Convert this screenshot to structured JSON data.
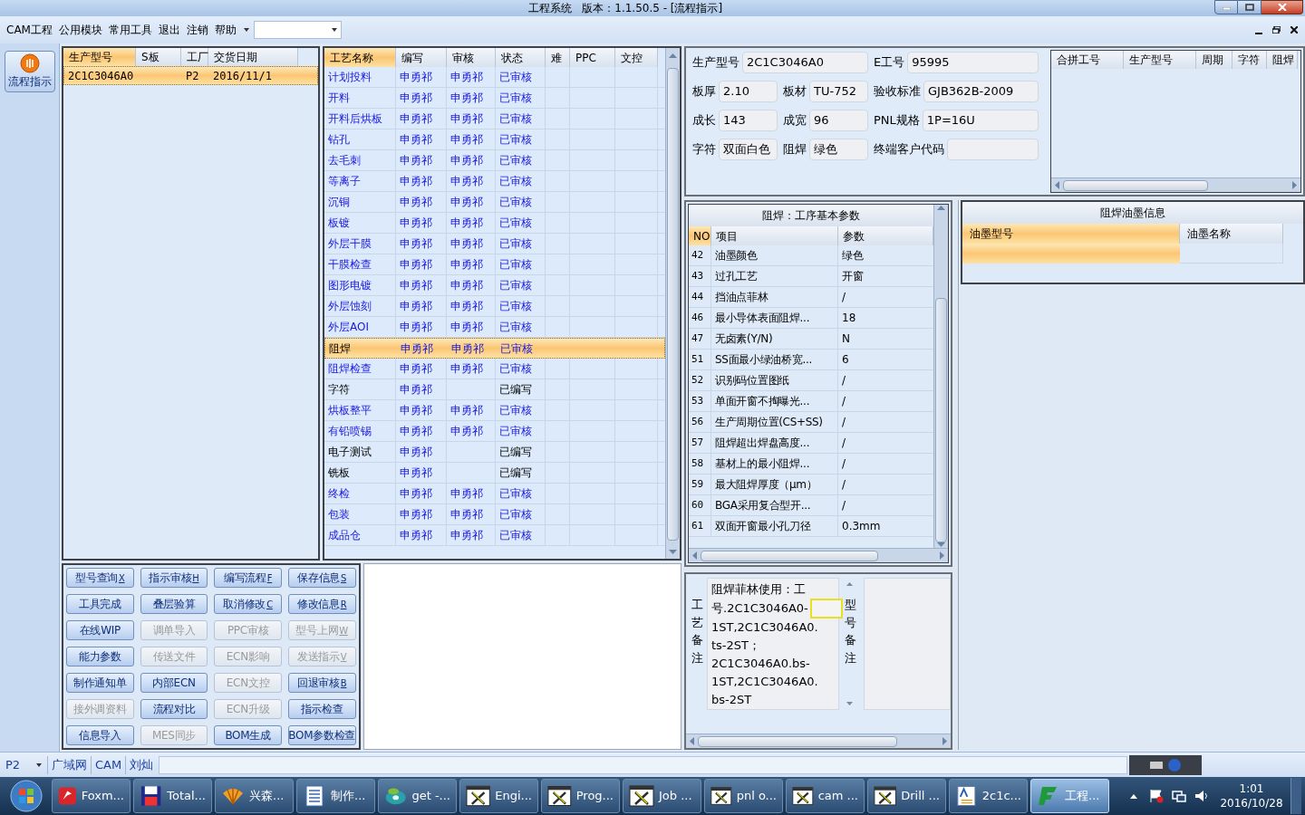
{
  "window": {
    "title": "工程系统   版本：1.1.50.5 - [流程指示]"
  },
  "menu": [
    {
      "label": "CAM工程"
    },
    {
      "label": "公用模块"
    },
    {
      "label": "常用工具"
    },
    {
      "label": "退出"
    },
    {
      "label": "注销"
    },
    {
      "label": "帮助"
    }
  ],
  "side_tool": {
    "label": "流程指示",
    "selected": true
  },
  "order_list": {
    "columns": [
      {
        "label": "生产型号",
        "selected": true
      },
      {
        "label": "S板",
        "selected": false
      },
      {
        "label": "工厂",
        "selected": false
      },
      {
        "label": "交货日期",
        "selected": false
      }
    ],
    "rows": [
      {
        "model": "2C1C3046A0",
        "factory": "P2",
        "date": "2016/11/1",
        "selected": true
      }
    ]
  },
  "process_table": {
    "columns": [
      {
        "label": "工艺名称",
        "selected": true
      },
      {
        "label": "编写",
        "selected": false
      },
      {
        "label": "审核",
        "selected": false
      },
      {
        "label": "状态",
        "selected": false
      },
      {
        "label": "难",
        "selected": false
      },
      {
        "label": "PPC",
        "selected": false
      },
      {
        "label": "文控",
        "selected": false
      }
    ],
    "rows": [
      {
        "name": "计划投料",
        "writer": "申勇祁",
        "reviewer": "申勇祁",
        "status": "已审核",
        "reviewed": true,
        "selected": false
      },
      {
        "name": "开料",
        "writer": "申勇祁",
        "reviewer": "申勇祁",
        "status": "已审核",
        "reviewed": true,
        "selected": false
      },
      {
        "name": "开料后烘板",
        "writer": "申勇祁",
        "reviewer": "申勇祁",
        "status": "已审核",
        "reviewed": true,
        "selected": false
      },
      {
        "name": "钻孔",
        "writer": "申勇祁",
        "reviewer": "申勇祁",
        "status": "已审核",
        "reviewed": true,
        "selected": false
      },
      {
        "name": "去毛刺",
        "writer": "申勇祁",
        "reviewer": "申勇祁",
        "status": "已审核",
        "reviewed": true,
        "selected": false
      },
      {
        "name": "等离子",
        "writer": "申勇祁",
        "reviewer": "申勇祁",
        "status": "已审核",
        "reviewed": true,
        "selected": false
      },
      {
        "name": "沉铜",
        "writer": "申勇祁",
        "reviewer": "申勇祁",
        "status": "已审核",
        "reviewed": true,
        "selected": false
      },
      {
        "name": "板镀",
        "writer": "申勇祁",
        "reviewer": "申勇祁",
        "status": "已审核",
        "reviewed": true,
        "selected": false
      },
      {
        "name": "外层干膜",
        "writer": "申勇祁",
        "reviewer": "申勇祁",
        "status": "已审核",
        "reviewed": true,
        "selected": false
      },
      {
        "name": "干膜检查",
        "writer": "申勇祁",
        "reviewer": "申勇祁",
        "status": "已审核",
        "reviewed": true,
        "selected": false
      },
      {
        "name": "图形电镀",
        "writer": "申勇祁",
        "reviewer": "申勇祁",
        "status": "已审核",
        "reviewed": true,
        "selected": false
      },
      {
        "name": "外层蚀刻",
        "writer": "申勇祁",
        "reviewer": "申勇祁",
        "status": "已审核",
        "reviewed": true,
        "selected": false
      },
      {
        "name": "外层AOI",
        "writer": "申勇祁",
        "reviewer": "申勇祁",
        "status": "已审核",
        "reviewed": true,
        "selected": false
      },
      {
        "name": "阻焊",
        "writer": "申勇祁",
        "reviewer": "申勇祁",
        "status": "已审核",
        "reviewed": true,
        "selected": true
      },
      {
        "name": "阻焊检查",
        "writer": "申勇祁",
        "reviewer": "申勇祁",
        "status": "已审核",
        "reviewed": true,
        "selected": false
      },
      {
        "name": "字符",
        "writer": "申勇祁",
        "status": "已编写",
        "reviewed": false,
        "selected": false
      },
      {
        "name": "烘板整平",
        "writer": "申勇祁",
        "reviewer": "申勇祁",
        "status": "已审核",
        "reviewed": true,
        "selected": false
      },
      {
        "name": "有铅喷锡",
        "writer": "申勇祁",
        "reviewer": "申勇祁",
        "status": "已审核",
        "reviewed": true,
        "selected": false
      },
      {
        "name": "电子测试",
        "writer": "申勇祁",
        "status": "已编写",
        "reviewed": false,
        "selected": false
      },
      {
        "name": "铣板",
        "writer": "申勇祁",
        "status": "已编写",
        "reviewed": false,
        "selected": false
      },
      {
        "name": "终检",
        "writer": "申勇祁",
        "reviewer": "申勇祁",
        "status": "已审核",
        "reviewed": true,
        "selected": false
      },
      {
        "name": "包装",
        "writer": "申勇祁",
        "reviewer": "申勇祁",
        "status": "已审核",
        "reviewed": true,
        "selected": false
      },
      {
        "name": "成品仓",
        "writer": "申勇祁",
        "reviewer": "申勇祁",
        "status": "已审核",
        "reviewed": true,
        "selected": false
      }
    ]
  },
  "buttons": [
    {
      "label": "型号查询",
      "shortcut": "X",
      "disabled": false
    },
    {
      "label": "指示审核",
      "shortcut": "H",
      "disabled": false
    },
    {
      "label": "编写流程",
      "shortcut": "F",
      "disabled": false
    },
    {
      "label": "保存信息",
      "shortcut": "S",
      "disabled": false
    },
    {
      "label": "工具完成",
      "disabled": false
    },
    {
      "label": "叠层验算",
      "disabled": false
    },
    {
      "label": "取消修改",
      "shortcut": "C",
      "disabled": false
    },
    {
      "label": "修改信息",
      "shortcut": "R",
      "disabled": false
    },
    {
      "label": "在线WIP",
      "disabled": false
    },
    {
      "label": "调单导入",
      "disabled": true
    },
    {
      "label": "PPC审核",
      "disabled": true
    },
    {
      "label": "型号上网",
      "shortcut": "W",
      "disabled": true
    },
    {
      "label": "能力参数",
      "disabled": false
    },
    {
      "label": "传送文件",
      "disabled": true
    },
    {
      "label": "ECN影响",
      "disabled": true
    },
    {
      "label": "发送指示",
      "shortcut": "V",
      "disabled": true
    },
    {
      "label": "制作通知单",
      "disabled": false
    },
    {
      "label": "内部ECN",
      "disabled": false
    },
    {
      "label": "ECN文控",
      "disabled": true
    },
    {
      "label": "回退审核",
      "shortcut": "B",
      "disabled": false
    },
    {
      "label": "接外调资料",
      "disabled": true
    },
    {
      "label": "流程对比",
      "disabled": false
    },
    {
      "label": "ECN升级",
      "disabled": true
    },
    {
      "label": "指示检查",
      "disabled": false
    },
    {
      "label": "信息导入",
      "disabled": false
    },
    {
      "label": "MES同步",
      "disabled": true
    },
    {
      "label": "BOM生成",
      "disabled": false
    },
    {
      "label": "BOM参数检查",
      "disabled": false
    }
  ],
  "info": {
    "fields": [
      {
        "label": "生产型号",
        "value": "2C1C3046A0"
      },
      {
        "label": "E工号",
        "value": "95995"
      },
      {
        "label": "板厚",
        "value": "2.10"
      },
      {
        "label": "板材",
        "value": "TU-752"
      },
      {
        "label": "验收标准",
        "value": "GJB362B-2009"
      },
      {
        "label": "成长",
        "value": "143"
      },
      {
        "label": "成宽",
        "value": "96"
      },
      {
        "label": "PNL规格",
        "value": "1P=16U"
      },
      {
        "label": "字符",
        "value": "双面白色"
      },
      {
        "label": "阻焊",
        "value": "绿色"
      },
      {
        "label": "终端客户代码"
      }
    ]
  },
  "merge_table": {
    "columns": [
      "合拼工号",
      "生产型号",
      "周期",
      "字符",
      "阻焊"
    ]
  },
  "params": {
    "title": "阻焊：工序基本参数",
    "columns": [
      {
        "label": "NO",
        "selected": true
      },
      {
        "label": "项目",
        "selected": false
      },
      {
        "label": "参数",
        "selected": false
      }
    ],
    "rows": [
      {
        "no": "42",
        "item": "油墨颜色",
        "value": "绿色"
      },
      {
        "no": "43",
        "item": "过孔工艺",
        "value": "开窗"
      },
      {
        "no": "44",
        "item": "挡油点菲林",
        "value": "/"
      },
      {
        "no": "46",
        "item": "最小导体表面阻焊...",
        "value": "18"
      },
      {
        "no": "47",
        "item": "无卤素(Y/N)",
        "value": "N"
      },
      {
        "no": "51",
        "item": "SS面最小绿油桥宽...",
        "value": "6"
      },
      {
        "no": "52",
        "item": "识别码位置图纸",
        "value": "/"
      },
      {
        "no": "53",
        "item": "单面开窗不掏曝光...",
        "value": "/"
      },
      {
        "no": "56",
        "item": "生产周期位置(CS+SS)",
        "value": "/"
      },
      {
        "no": "57",
        "item": "阻焊超出焊盘高度...",
        "value": "/"
      },
      {
        "no": "58",
        "item": "基材上的最小阻焊...",
        "value": "/"
      },
      {
        "no": "59",
        "item": "最大阻焊厚度（μm）",
        "value": "/"
      },
      {
        "no": "60",
        "item": "BGA采用复合型开...",
        "value": "/"
      },
      {
        "no": "61",
        "item": "双面开窗最小孔刀径",
        "value": "0.3mm"
      }
    ]
  },
  "ink": {
    "title": "阻焊油墨信息",
    "columns": [
      {
        "label": "油墨型号",
        "selected": true
      },
      {
        "label": "油墨名称",
        "selected": false
      }
    ],
    "rows": [
      {
        "selected": true
      }
    ]
  },
  "notes": {
    "process_label": "工艺备注",
    "process_lines": [
      "阻焊菲林使用：工",
      "号.2C1C3046A0-",
      "1ST,2C1C3046A0.",
      "ts-2ST；",
      "2C1C3046A0.bs-",
      "1ST,2C1C3046A0.",
      "bs-2ST"
    ],
    "model_label": "型号备注"
  },
  "status_bar": {
    "factory": "P2",
    "items": [
      "广域网",
      "CAM",
      "刘灿"
    ]
  },
  "taskbar": {
    "items": [
      {
        "label": "Foxm...",
        "kind": "mail",
        "selected": false
      },
      {
        "label": "Total...",
        "kind": "disk",
        "selected": false
      },
      {
        "label": "兴森...",
        "kind": "shell",
        "selected": false
      },
      {
        "label": "制作...",
        "kind": "doc",
        "selected": false
      },
      {
        "label": "get -...",
        "kind": "disc",
        "selected": false
      },
      {
        "label": "Engi...",
        "kind": "x",
        "selected": false
      },
      {
        "label": "Prog...",
        "kind": "x",
        "selected": false
      },
      {
        "label": "Job ...",
        "kind": "x",
        "selected": false
      },
      {
        "label": "pnl o...",
        "kind": "x",
        "selected": false
      },
      {
        "label": "cam ...",
        "kind": "x",
        "selected": false
      },
      {
        "label": "Drill ...",
        "kind": "x",
        "selected": false
      },
      {
        "label": "2c1c...",
        "kind": "text",
        "selected": false
      },
      {
        "label": "工程...",
        "kind": "app",
        "selected": true
      }
    ],
    "clock": {
      "time": "1:01",
      "date": "2016/10/28"
    }
  }
}
